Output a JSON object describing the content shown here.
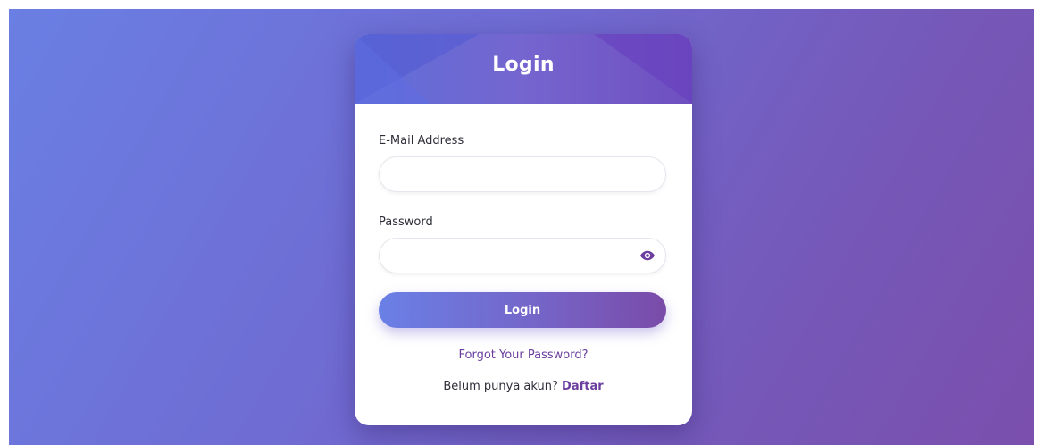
{
  "card": {
    "title": "Login"
  },
  "form": {
    "email_label": "E-Mail Address",
    "email_value": "",
    "password_label": "Password",
    "password_value": "",
    "password_toggle_icon": "eye-icon",
    "submit_label": "Login",
    "forgot_label": "Forgot Your Password?",
    "register_prompt": "Belum punya akun?",
    "register_link": "Daftar"
  },
  "colors": {
    "accent": "#6a3d9e",
    "gradient_start": "#6a80e6",
    "gradient_end": "#7a4ba8"
  }
}
